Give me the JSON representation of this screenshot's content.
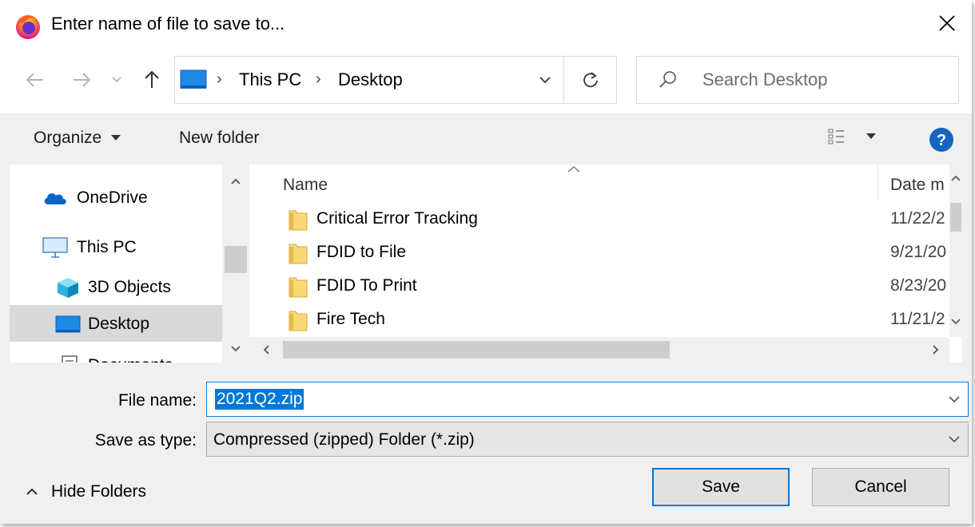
{
  "window": {
    "title": "Enter name of file to save to...",
    "app_icon": "firefox-icon",
    "close_icon": "close-icon"
  },
  "navigation": {
    "back_icon": "arrow-left-icon",
    "forward_icon": "arrow-right-icon",
    "recent_icon": "chevron-down-icon",
    "up_icon": "arrow-up-icon",
    "address": {
      "crumbs": [
        "This PC",
        "Desktop"
      ],
      "separator": "›"
    },
    "refresh_icon": "refresh-icon",
    "search": {
      "placeholder": "Search Desktop"
    }
  },
  "toolbar": {
    "organize_label": "Organize",
    "new_folder_label": "New folder",
    "view_icon": "view-details-icon",
    "help_icon": "help-icon"
  },
  "nav_pane": {
    "items": [
      {
        "label": "OneDrive",
        "icon": "cloud-icon"
      },
      {
        "label": "This PC",
        "icon": "monitor-icon"
      },
      {
        "label": "3D Objects",
        "icon": "cube-icon"
      },
      {
        "label": "Desktop",
        "icon": "desktop-icon",
        "selected": true
      },
      {
        "label": "Documents",
        "icon": "document-icon"
      }
    ]
  },
  "file_list": {
    "columns": {
      "name": "Name",
      "date": "Date m"
    },
    "rows": [
      {
        "name": "Critical Error Tracking",
        "date": "11/22/2"
      },
      {
        "name": "FDID to File",
        "date": "9/21/20"
      },
      {
        "name": "FDID To Print",
        "date": "8/23/20"
      },
      {
        "name": "Fire Tech",
        "date": "11/21/2"
      }
    ]
  },
  "form": {
    "file_name_label": "File name:",
    "file_name_value": "2021Q2.zip",
    "save_type_label": "Save as type:",
    "save_type_value": "Compressed (zipped) Folder (*.zip)"
  },
  "footer": {
    "hide_folders_label": "Hide Folders",
    "save_label": "Save",
    "cancel_label": "Cancel"
  },
  "colors": {
    "accent": "#0078d7",
    "selection": "#d9d9d9",
    "folder": "#f8d775"
  }
}
